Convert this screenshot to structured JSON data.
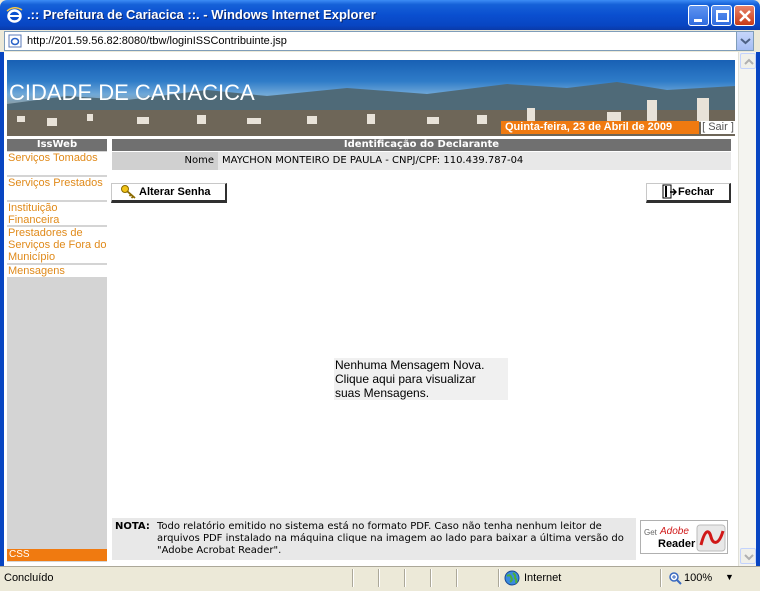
{
  "window": {
    "title": ".:: Prefeitura de Cariacica ::. - Windows Internet Explorer"
  },
  "address": {
    "url": "http://201.59.56.82:8080/tbw/loginISSContribuinte.jsp"
  },
  "banner": {
    "title": "CIDADE DE CARIACICA",
    "date": "Quinta-feira, 23 de Abril de 2009",
    "logout_label": "[ Sair ]"
  },
  "sidebar": {
    "header": "IssWeb",
    "items": [
      {
        "label": "Serviços Tomados"
      },
      {
        "label": "Serviços Prestados"
      },
      {
        "label": "Instituição Financeira"
      },
      {
        "label": "Prestadores de Serviços de Fora do Município"
      },
      {
        "label": "Mensagens"
      }
    ],
    "footer": "CSS"
  },
  "declarant": {
    "header": "Identificação do Declarante",
    "name_label": "Nome",
    "name_value": "MAYCHON MONTEIRO DE PAULA - CNPJ/CPF: 110.439.787-04"
  },
  "buttons": {
    "change_password": "Alterar Senha",
    "close": "Fechar"
  },
  "messages": {
    "line1": "Nenhuma Mensagem Nova.",
    "line2": "Clique aqui para visualizar",
    "line3": "suas Mensagens."
  },
  "note": {
    "label": "NOTA:",
    "text": "Todo relatório emitido no sistema está no formato PDF. Caso não tenha nenhum leitor de arquivos PDF instalado na máquina clique na imagem ao lado para baixar a última versão do \"Adobe Acrobat Reader\"."
  },
  "adobe": {
    "get": "Get",
    "brand": "Adobe",
    "product": "Reader"
  },
  "status": {
    "text": "Concluído",
    "zone": "Internet",
    "zoom": "100%"
  },
  "colors": {
    "accent": "#f07a10",
    "link": "#e08a1a",
    "header_gray": "#707070",
    "xp_blue": "#0845c2"
  }
}
